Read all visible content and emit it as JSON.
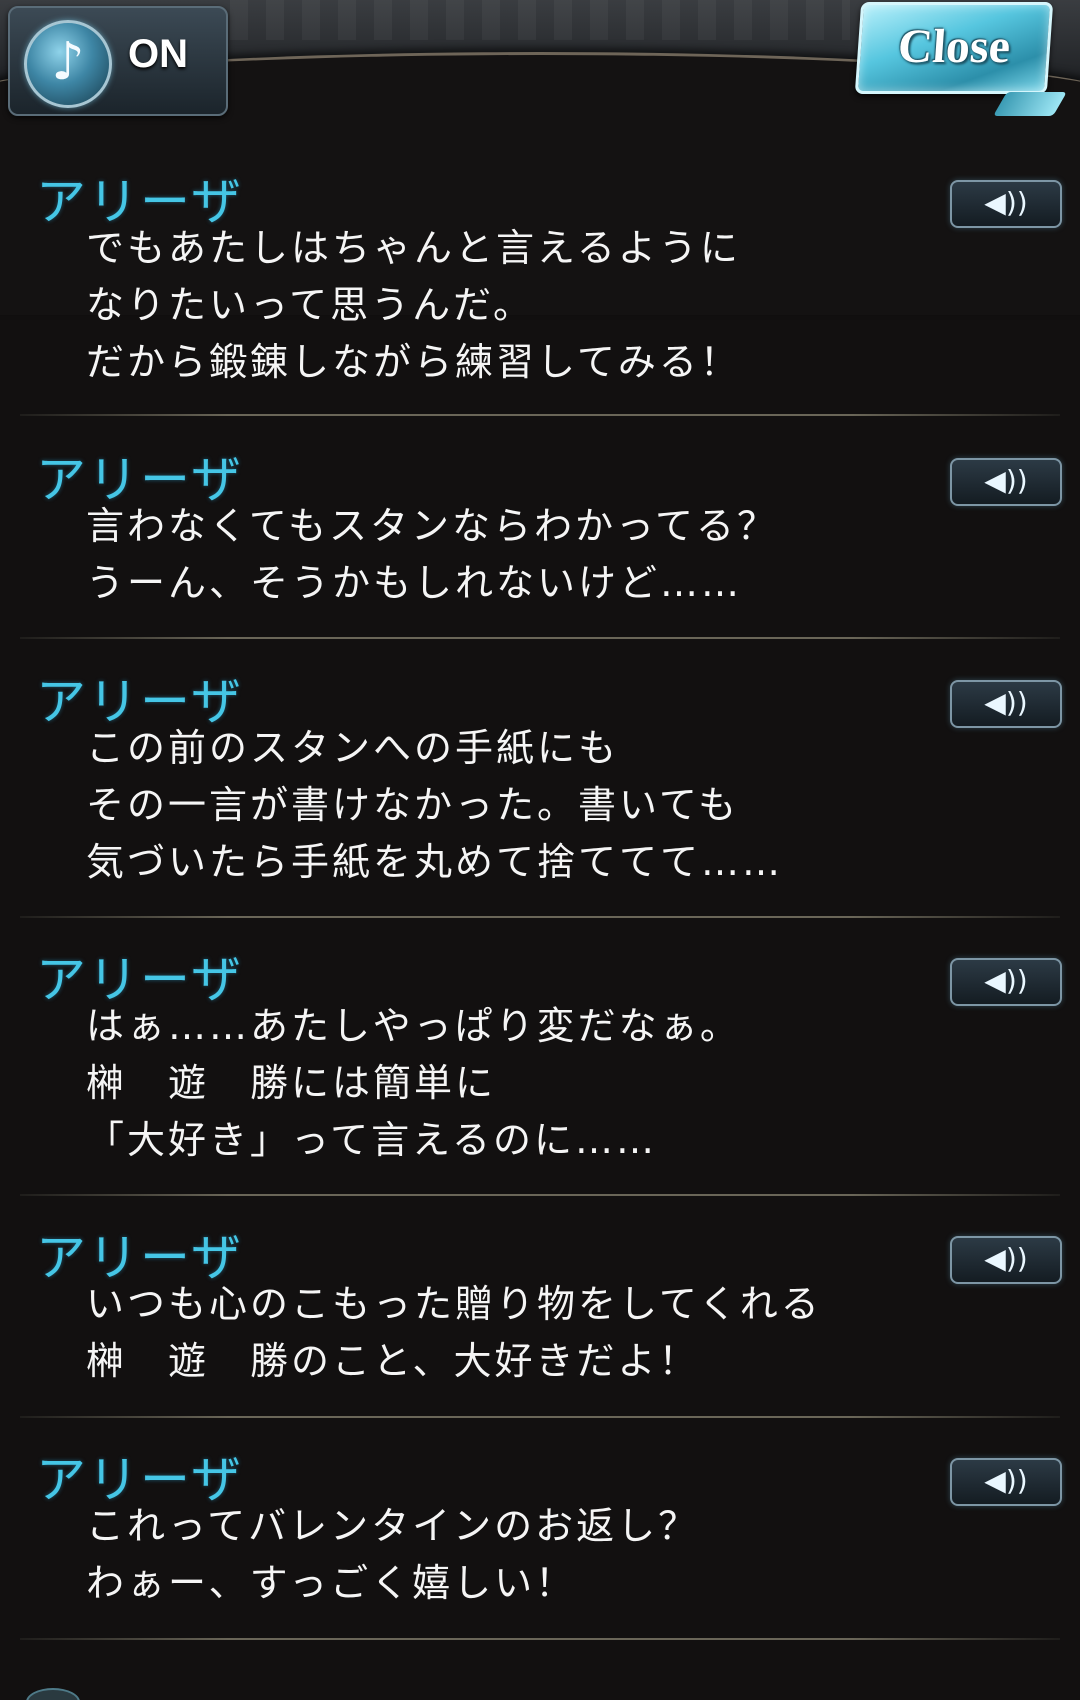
{
  "header": {
    "bgm_icon": "music-note-icon",
    "bgm_icon_glyph": "♪",
    "bgm_status": "ON",
    "close_label": "Close"
  },
  "voice_icon_glyph": "◀))",
  "entries": [
    {
      "speaker": "アリーザ",
      "lines": [
        "でもあたしはちゃんと言えるように",
        "なりたいって思うんだ。",
        "だから鍛錬しながら練習してみる！"
      ]
    },
    {
      "speaker": "アリーザ",
      "lines": [
        "言わなくてもスタンならわかってる？",
        "うーん、そうかもしれないけど……"
      ]
    },
    {
      "speaker": "アリーザ",
      "lines": [
        "この前のスタンへの手紙にも",
        "その一言が書けなかった。書いても",
        "気づいたら手紙を丸めて捨ててて……"
      ]
    },
    {
      "speaker": "アリーザ",
      "lines": [
        "はぁ……あたしやっぱり変だなぁ。",
        "榊　遊　勝には簡単に",
        "「大好き」って言えるのに……"
      ]
    },
    {
      "speaker": "アリーザ",
      "lines": [
        "いつも心のこもった贈り物をしてくれる",
        "榊　遊　勝のこと、大好きだよ！"
      ]
    },
    {
      "speaker": "アリーザ",
      "lines": [
        "これってバレンタインのお返し？",
        "わぁー、すっごく嬉しい！"
      ]
    }
  ]
}
